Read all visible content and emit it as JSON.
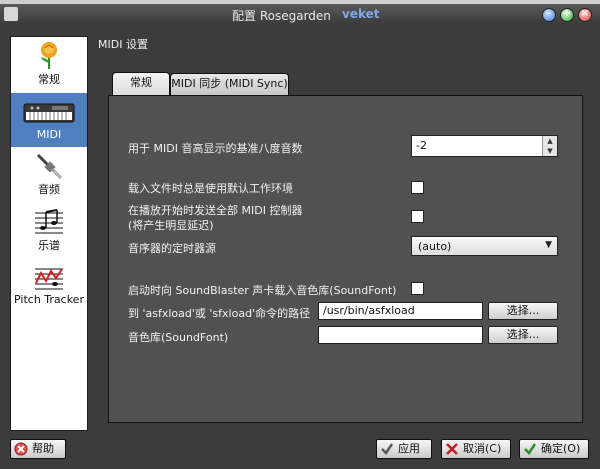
{
  "window": {
    "title": "配置 Rosegarden",
    "brand": "veket"
  },
  "sidebar": {
    "items": [
      {
        "label": "常规",
        "icon": "rose-icon"
      },
      {
        "label": "MIDI",
        "icon": "keyboard-icon",
        "selected": true
      },
      {
        "label": "音频",
        "icon": "audio-plug-icon"
      },
      {
        "label": "乐谱",
        "icon": "notation-icon"
      },
      {
        "label": "Pitch Tracker",
        "icon": "pitch-tracker-icon"
      }
    ]
  },
  "section": {
    "title": "MIDI 设置"
  },
  "tabs": [
    {
      "label": "常规",
      "active": true
    },
    {
      "label": "MIDI 同步 (MIDI Sync)",
      "active": false
    }
  ],
  "general": {
    "octave_label": "用于 MIDI 音高显示的基准八度音数",
    "octave_value": "-2",
    "default_studio_label": "载入文件时总是使用默认工作环境",
    "send_controllers_label_1": "在播放开始时发送全部 MIDI 控制器",
    "send_controllers_label_2": "(将产生明显延迟)",
    "timer_label": "音序器的定时器源",
    "timer_value": "(auto)",
    "soundfont_load_label": "启动时向 SoundBlaster 声卡载入音色库(SoundFont)",
    "sfxload_path_label": "到 'asfxload'或 'sfxload'命令的路径",
    "sfxload_path_value": "/usr/bin/asfxload",
    "soundfont_label": "音色库(SoundFont)",
    "soundfont_value": "",
    "browse_label": "选择..."
  },
  "buttons": {
    "help": "帮助",
    "apply": "应用",
    "cancel": "取消(C)",
    "ok": "确定(O)"
  }
}
